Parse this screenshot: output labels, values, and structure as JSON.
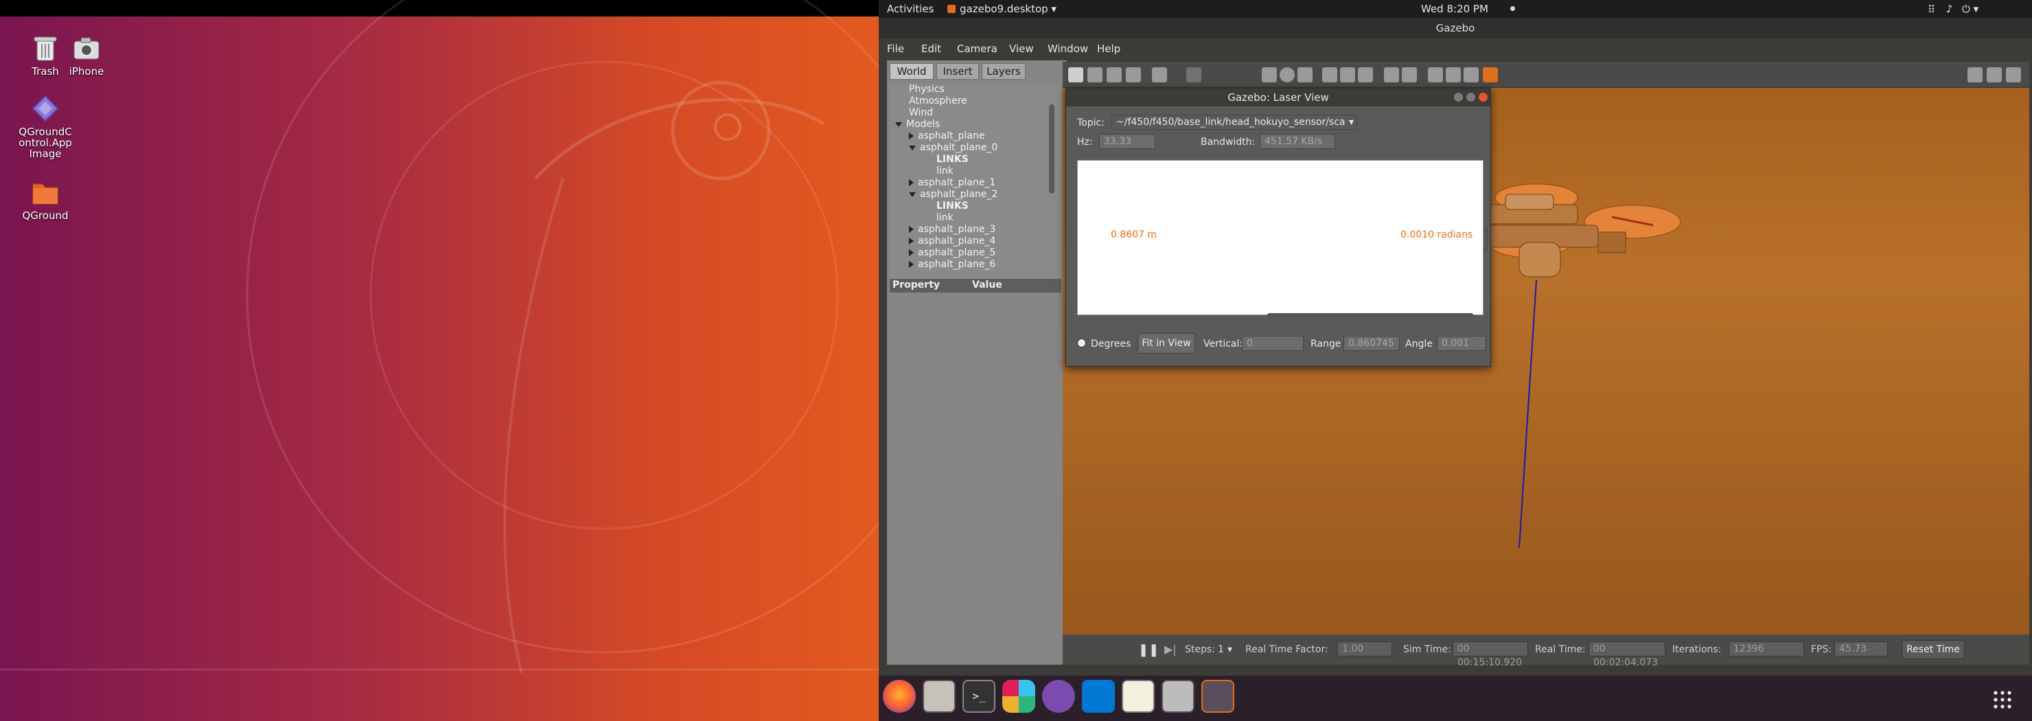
{
  "desktop": {
    "icons": [
      {
        "label": "Trash"
      },
      {
        "label": "iPhone"
      },
      {
        "label": "QGroundControl.AppImage"
      },
      {
        "label": "QGround"
      }
    ]
  },
  "topbar": {
    "activities": "Activities",
    "app": "gazebo9.desktop ▾",
    "clock": "Wed  8:20 PM"
  },
  "window": {
    "title": "Gazebo"
  },
  "menu": {
    "file": "File",
    "edit": "Edit",
    "camera": "Camera",
    "view": "View",
    "window": "Window",
    "help": "Help"
  },
  "leftpanel": {
    "tabs": {
      "world": "World",
      "insert": "Insert",
      "layers": "Layers"
    },
    "tree": {
      "physics": "Physics",
      "atmosphere": "Atmosphere",
      "wind": "Wind",
      "models": "Models",
      "items": [
        "asphalt_plane",
        "asphalt_plane_0",
        "LINKS",
        "link",
        "asphalt_plane_1",
        "asphalt_plane_2",
        "LINKS",
        "link",
        "asphalt_plane_3",
        "asphalt_plane_4",
        "asphalt_plane_5",
        "asphalt_plane_6"
      ]
    },
    "props": {
      "property": "Property",
      "value": "Value"
    }
  },
  "laser": {
    "title": "Gazebo: Laser View",
    "topic_label": "Topic:",
    "topic": "~/f450/f450/base_link/head_hokuyo_sensor/sca",
    "hz_label": "Hz:",
    "hz": "33.33",
    "bandwidth_label": "Bandwidth:",
    "bandwidth": "451.57 KB/s",
    "range_text": "0.8607 m",
    "angle_text": "0.0010 radians",
    "degrees": "Degrees",
    "fit": "Fit in View",
    "vertical_label": "Vertical:",
    "vertical": "0",
    "range_label": "Range",
    "range": "0.860745",
    "angle_label": "Angle",
    "angle": "0.001"
  },
  "bottom": {
    "steps_label": "Steps:",
    "steps": "1",
    "rtf_label": "Real Time Factor:",
    "rtf": "1.00",
    "sim_label": "Sim Time:",
    "sim": "00 00:15:10.920",
    "real_label": "Real Time:",
    "real": "00 00:02:04.073",
    "iter_label": "Iterations:",
    "iter": "12396",
    "fps_label": "FPS:",
    "fps": "45.73",
    "reset": "Reset Time"
  },
  "colors": {
    "laser_text": "#f07010",
    "orange_accent": "#e06e1c",
    "panel_bg": "#858585"
  }
}
